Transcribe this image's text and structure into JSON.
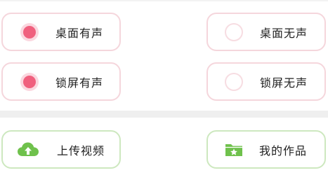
{
  "ringtone_options": [
    {
      "label": "桌面有声",
      "selected": true
    },
    {
      "label": "桌面无声",
      "selected": false
    },
    {
      "label": "锁屏有声",
      "selected": true
    },
    {
      "label": "锁屏无声",
      "selected": false
    }
  ],
  "actions": {
    "upload_label": "上传视频",
    "upload_icon": "cloud-upload-icon",
    "my_works_label": "我的作品",
    "my_works_icon": "folder-star-icon"
  },
  "colors": {
    "radio_selected": "#f0607e",
    "radio_halo": "#fbd7df",
    "pink_border": "#f5d6dc",
    "green_border": "#cde8bf",
    "icon_green": "#6fc14c"
  }
}
